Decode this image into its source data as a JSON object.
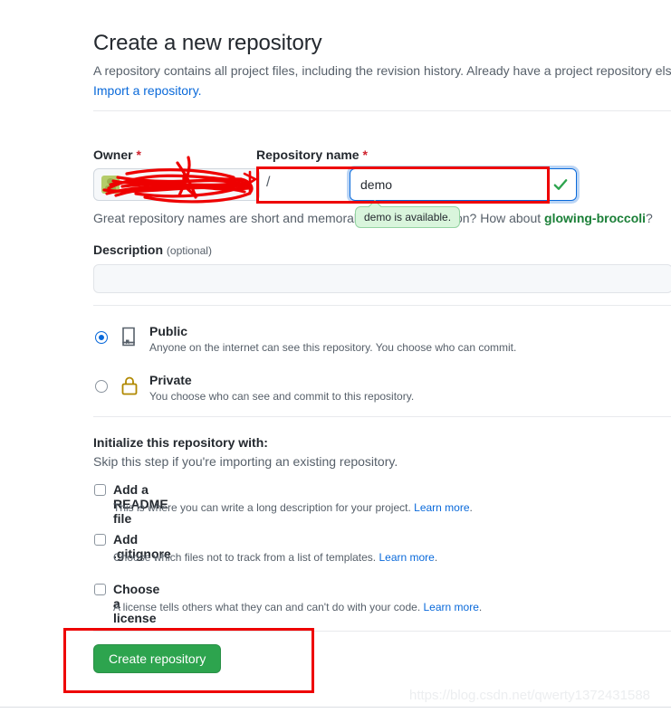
{
  "header": {
    "title": "Create a new repository",
    "subtitle_text": "A repository contains all project files, including the revision history. Already have a project repository els",
    "import_link": "Import a repository."
  },
  "owner": {
    "label": "Owner",
    "required_mark": "*",
    "selected_value": "",
    "avatar_icon": "user-avatar-icon",
    "caret_icon": "chevron-down-icon",
    "separator": "/"
  },
  "repository_name": {
    "label": "Repository name",
    "required_mark": "*",
    "value": "demo",
    "placeholder": "",
    "valid_icon": "check-icon",
    "availability_tooltip": "demo is available.",
    "hint_prefix": "Great repository names are short and memorable. Need inspiration? How about ",
    "hint_suggestion": "glowing-broccoli",
    "hint_suffix": "?"
  },
  "description": {
    "label": "Description",
    "optional_label": "(optional)",
    "value": "",
    "placeholder": ""
  },
  "visibility": {
    "options": [
      {
        "id": "public",
        "title": "Public",
        "description": "Anyone on the internet can see this repository. You choose who can commit.",
        "icon": "book-icon",
        "selected": true
      },
      {
        "id": "private",
        "title": "Private",
        "description": "You choose who can see and commit to this repository.",
        "icon": "lock-icon",
        "selected": false
      }
    ]
  },
  "initialize": {
    "title": "Initialize this repository with:",
    "subtitle": "Skip this step if you're importing an existing repository.",
    "options": [
      {
        "id": "readme",
        "title": "Add a README file",
        "description": "This is where you can write a long description for your project. ",
        "link_text": "Learn more",
        "description_suffix": ".",
        "checked": false
      },
      {
        "id": "gitignore",
        "title": "Add .gitignore",
        "description": "Choose which files not to track from a list of templates. ",
        "link_text": "Learn more",
        "description_suffix": ".",
        "checked": false
      },
      {
        "id": "license",
        "title": "Choose a license",
        "description": "A license tells others what they can and can't do with your code. ",
        "link_text": "Learn more",
        "description_suffix": ".",
        "checked": false
      }
    ]
  },
  "actions": {
    "create_label": "Create repository"
  },
  "watermark": {
    "text": "https://blog.csdn.net/qwerty1372431588"
  },
  "annotations": {
    "highlight_color": "#ee0000",
    "scribble_color": "#ee0000",
    "boxes": [
      "repository-name-field",
      "create-repository-button"
    ],
    "scribbles": [
      "owner-field-redaction"
    ]
  },
  "colors": {
    "link": "#0969da",
    "required": "#cf222e",
    "success_green": "#1a7f37",
    "button_green": "#2da44e",
    "tooltip_bg": "#d9f5dc",
    "lock_gold": "#b08800",
    "muted_text": "#57606a"
  }
}
